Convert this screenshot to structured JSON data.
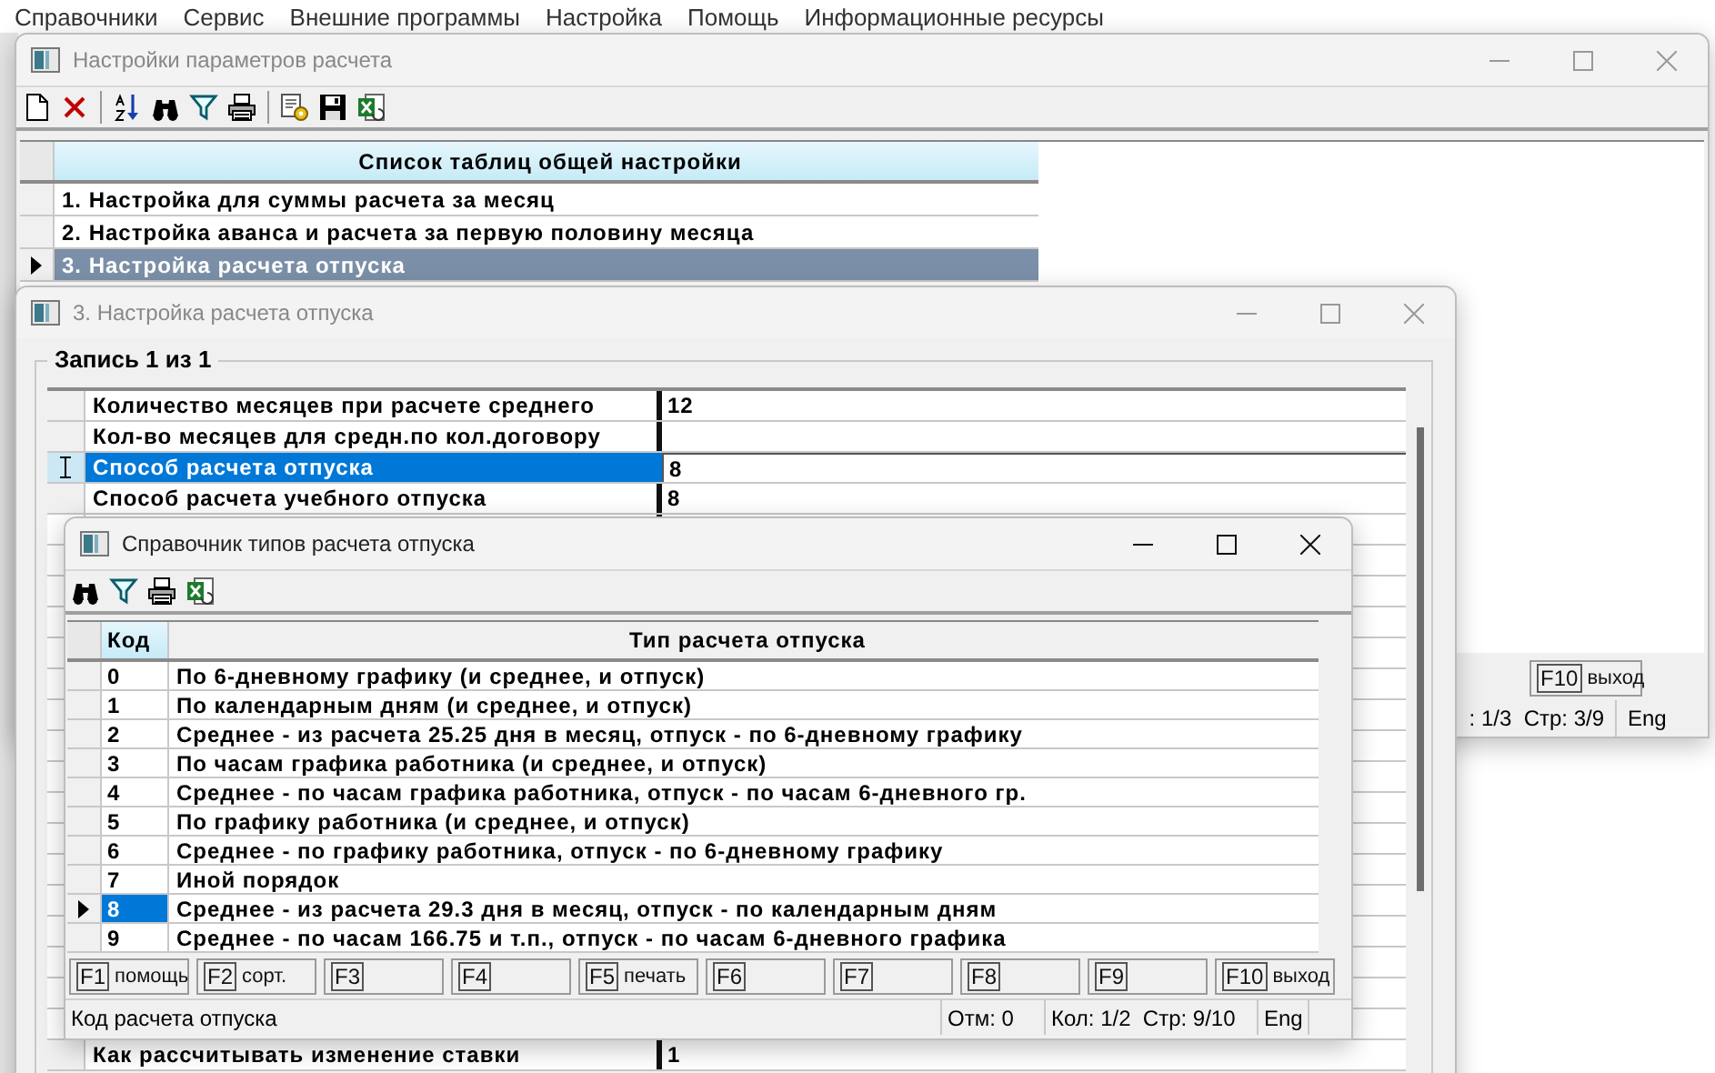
{
  "menu": [
    "Справочники",
    "Сервис",
    "Внешние программы",
    "Настройка",
    "Помощь",
    "Информационные ресурсы"
  ],
  "settings_window": {
    "title": "Настройки параметров расчета",
    "table": {
      "columns": [
        "Список таблиц общей настройки"
      ],
      "rows": [
        {
          "text": "1. Настройка для суммы расчета за месяц",
          "selected": false
        },
        {
          "text": "2. Настройка аванса и расчета за первую половину месяца",
          "selected": false
        },
        {
          "text": "3. Настройка расчета отпуска",
          "selected": true
        }
      ]
    },
    "function_keys": [
      {
        "key": "F10",
        "label": "выход"
      }
    ],
    "status_bar": [
      ": 1/3  Стр: 3/9",
      "Eng"
    ]
  },
  "record_window": {
    "title": "3. Настройка расчета отпуска",
    "group_title": "Запись 1 из 1",
    "fields": [
      {
        "label": "Количество месяцев при расчете среднего",
        "value": "12",
        "selected": false
      },
      {
        "label": "Кол-во месяцев для средн.по кол.договору",
        "selected": false
      },
      {
        "label": "Способ расчета отпуска",
        "value": "8",
        "selected": true
      },
      {
        "label": "Способ расчета учебного отпуска",
        "value": "8",
        "selected": false
      },
      {
        "label": "Как рассчитывать изменение ставки",
        "value": "1",
        "selected": false
      }
    ]
  },
  "lookup_window": {
    "title": "Справочник типов расчета отпуска",
    "table": {
      "columns": [
        "Код",
        "Тип расчета отпуска"
      ],
      "rows": [
        {
          "code": "0",
          "type": "По 6-дневному графику (и среднее, и отпуск)",
          "selected": false
        },
        {
          "code": "1",
          "type": "По календарным дням (и среднее, и отпуск)",
          "selected": false
        },
        {
          "code": "2",
          "type": "Среднее - из расчета 25.25 дня в месяц, отпуск - по 6-дневному графику",
          "selected": false
        },
        {
          "code": "3",
          "type": "По часам графика работника (и среднее, и отпуск)",
          "selected": false
        },
        {
          "code": "4",
          "type": "Среднее - по часам графика работника, отпуск - по часам 6-дневного гр.",
          "selected": false
        },
        {
          "code": "5",
          "type": "По графику работника (и среднее, и отпуск)",
          "selected": false
        },
        {
          "code": "6",
          "type": "Среднее - по графику работника, отпуск - по 6-дневному графику",
          "selected": false
        },
        {
          "code": "7",
          "type": "Иной порядок",
          "selected": false
        },
        {
          "code": "8",
          "type": "Среднее - из расчета 29.3 дня в месяц, отпуск - по календарным дням",
          "selected": true
        },
        {
          "code": "9",
          "type": "Среднее - по часам 166.75 и т.п., отпуск - по часам 6-дневного графика",
          "selected": false
        }
      ]
    },
    "function_keys": [
      {
        "key": "F1",
        "label": "помощь"
      },
      {
        "key": "F2",
        "label": "сорт."
      },
      {
        "key": "F3"
      },
      {
        "key": "F4"
      },
      {
        "key": "F5",
        "label": "печать"
      },
      {
        "key": "F6"
      },
      {
        "key": "F7"
      },
      {
        "key": "F8"
      },
      {
        "key": "F9"
      },
      {
        "key": "F10",
        "label": "выход"
      }
    ],
    "status_bar": [
      "Код расчета отпуска",
      "Отм: 0",
      "Кол: 1/2  Стр: 9/10",
      "Eng"
    ]
  }
}
